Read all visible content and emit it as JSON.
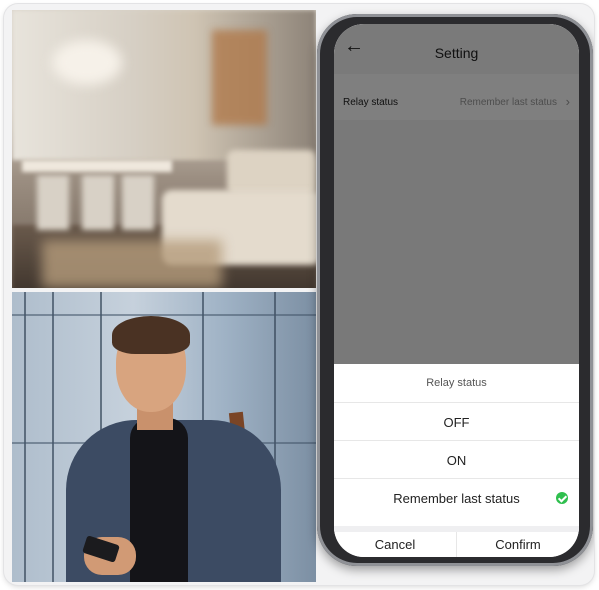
{
  "app": {
    "title": "Setting",
    "back_icon": "arrow-left-icon"
  },
  "settings": {
    "relay_status_label": "Relay status",
    "relay_status_value": "Remember last status",
    "chevron_icon": "chevron-right-icon"
  },
  "sheet": {
    "title": "Relay status",
    "options": [
      {
        "label": "OFF",
        "selected": false
      },
      {
        "label": "ON",
        "selected": false
      },
      {
        "label": "Remember last status",
        "selected": true
      }
    ],
    "cancel_label": "Cancel",
    "confirm_label": "Confirm",
    "check_icon": "check-circle-icon",
    "accent_color": "#2fbf4e"
  }
}
